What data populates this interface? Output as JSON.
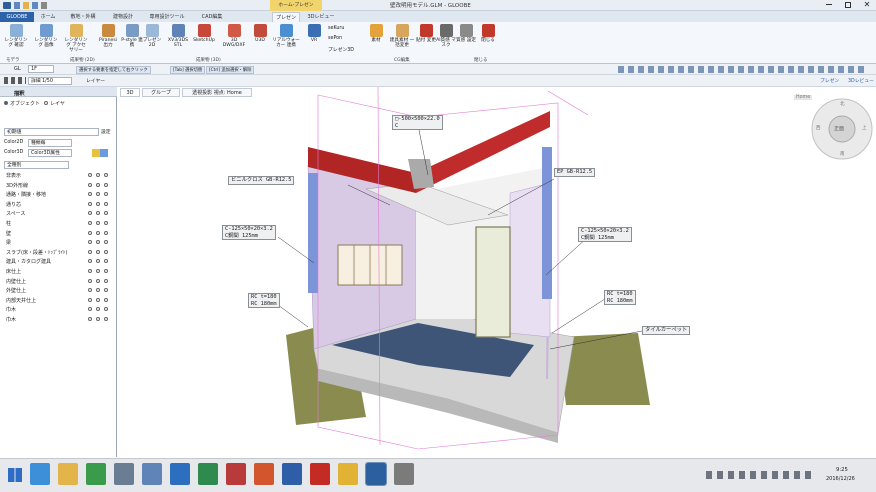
{
  "window": {
    "title": "壁改明用モデル.GLM - GLOOBE",
    "context_tab": "ホーム-プレゼン",
    "search_placeholder": "検索したい語を入力"
  },
  "tabs": [
    "GLOOBE",
    "ホーム",
    "敷地・外構",
    "建物設計",
    "専用設計ツール",
    "CAD編集",
    "プレゼン",
    "3Dレビュー"
  ],
  "ribbon": {
    "buttons": [
      {
        "label": "レンダリング 確認",
        "color": "#8ab0d8"
      },
      {
        "label": "レンダリング 画像",
        "color": "#6f9bcf"
      },
      {
        "label": "レンダリング アクセサリー",
        "color": "#e0b45a"
      },
      {
        "label": "Piranesi 出力",
        "color": "#c9893f"
      },
      {
        "label": "P-style 連携",
        "color": "#7a9cc4"
      },
      {
        "label": "プレゼン 2D",
        "color": "#9bb8d9"
      },
      {
        "label": "XV3/3DS STL",
        "color": "#5f83b6"
      },
      {
        "label": "SketchUp",
        "color": "#c8473a"
      },
      {
        "label": "3D DWG/DXF",
        "color": "#d05a45"
      },
      {
        "label": "U3D",
        "color": "#c24a3d"
      },
      {
        "label": "リアルウォーカー 連携",
        "color": "#4b8fd1"
      },
      {
        "label": "VR",
        "color": "#3a6fb4"
      },
      {
        "label": "素材",
        "color": "#e3a23a"
      },
      {
        "label": "建具素材 一括変更",
        "color": "#d8a55c"
      },
      {
        "label": "貼付 変更",
        "color": "#c0392b"
      },
      {
        "label": "AI質感 マスク",
        "color": "#6a6a6a"
      },
      {
        "label": "質感 設定",
        "color": "#8a8a8a"
      },
      {
        "label": "閉じる",
        "color": "#c0392b"
      }
    ],
    "small_buttons": [
      "seKuru",
      "sePon",
      "プレゼン3D"
    ],
    "groups": [
      "モデラ",
      "成果物 (2D)",
      "成果物 (3D)",
      "CG編集",
      "閉じる"
    ]
  },
  "toolbar1": {
    "floor": "GL",
    "floor_value": "1F",
    "hint_tags": [
      "選択する要素を指定して右クリック",
      "[Tab] 選択切替",
      "[Ctrl] 追加選択・解除"
    ]
  },
  "toolbar2": {
    "scale_label": "詳細 1/50",
    "layer_label": "レイヤー",
    "right_tabs": [
      "プレゼン",
      "3Dレビュー"
    ]
  },
  "viewport": {
    "tabs": [
      "3D",
      "グループ",
      "透視投影  視点: Home"
    ],
    "navcube": {
      "home": "Home",
      "top": "上",
      "front": "正面",
      "west": "西",
      "north": "北",
      "south": "南"
    },
    "callouts": [
      {
        "text": "□-500×500×22.0\nC"
      },
      {
        "text": "ビニルクロス GB-R12.5"
      },
      {
        "text": "EP GB-R12.5"
      },
      {
        "text": "C-125×50×20×3.2\nC鋼間 125mm"
      },
      {
        "text": "C-125×50×20×3.2\nC鋼間 125mm"
      },
      {
        "text": "RC t=180\nRC 180mm"
      },
      {
        "text": "RC t=180\nRC 180mm"
      },
      {
        "text": "タイルカーペット"
      }
    ]
  },
  "panel": {
    "title": "描釈",
    "radio_object": "オブジェクト",
    "radio_layer": "レイヤ",
    "preset": "初期値",
    "preset_button": "設定",
    "color2d_label": "Color2D",
    "color2d_value": "種類毎",
    "color3d_label": "Color3D",
    "color3d_value": "Color3D属性",
    "filter": "全種別",
    "items": [
      "非表示",
      "3D外形線",
      "通路・隣接・移地",
      "通り芯",
      "スペース",
      "柱",
      "壁",
      "梁",
      "スラブ(床・段差・ﾄｯﾌﾟﾗｲﾄ)",
      "建具・カタログ建具",
      "床仕上",
      "内壁仕上",
      "外壁仕上",
      "内部天井仕上",
      "巾木",
      "巾木"
    ]
  },
  "taskbar": {
    "time": "9:25",
    "date": "2016/12/26"
  }
}
